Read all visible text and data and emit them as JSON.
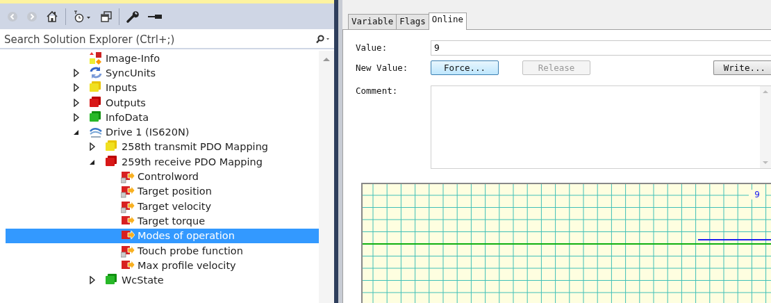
{
  "solution_explorer": {
    "toolbar": [
      {
        "kind": "back",
        "disabled": true
      },
      {
        "kind": "forward",
        "disabled": true
      },
      {
        "kind": "home"
      },
      {
        "kind": "separator"
      },
      {
        "kind": "history"
      },
      {
        "kind": "windows"
      },
      {
        "kind": "separator"
      },
      {
        "kind": "wrench"
      },
      {
        "kind": "pin"
      }
    ],
    "search": {
      "placeholder": "Search Solution Explorer (Ctrl+;)"
    },
    "tree": [
      {
        "label": "Image-Info",
        "kind": "image-info",
        "selected": false
      },
      {
        "label": "SyncUnits",
        "kind": "sync",
        "expanded": false,
        "selected": false
      },
      {
        "label": "Inputs",
        "kind": "inputs",
        "expanded": false,
        "selected": false
      },
      {
        "label": "Outputs",
        "kind": "outputs",
        "expanded": false,
        "selected": false
      },
      {
        "label": "InfoData",
        "kind": "info",
        "expanded": false,
        "selected": false
      },
      {
        "label": "Drive 1 (IS620N)",
        "kind": "drive",
        "expanded": true,
        "selected": false,
        "children": [
          {
            "label": "258th transmit PDO Mapping",
            "kind": "inputs",
            "expanded": false,
            "selected": false
          },
          {
            "label": "259th receive PDO Mapping",
            "kind": "outputs",
            "expanded": true,
            "selected": false,
            "children": [
              {
                "label": "Controlword",
                "kind": "linked-output-var",
                "selected": false
              },
              {
                "label": "Target position",
                "kind": "linked-output-var",
                "selected": false
              },
              {
                "label": "Target velocity",
                "kind": "linked-output-var",
                "selected": false
              },
              {
                "label": "Target torque",
                "kind": "output-var",
                "selected": false
              },
              {
                "label": "Modes of operation",
                "kind": "output-var",
                "selected": true
              },
              {
                "label": "Touch probe function",
                "kind": "linked-output-var",
                "selected": false
              },
              {
                "label": "Max profile velocity",
                "kind": "output-var",
                "selected": false
              }
            ]
          },
          {
            "label": "WcState",
            "kind": "info",
            "expanded": false,
            "selected": false
          }
        ]
      }
    ]
  },
  "properties": {
    "tabs": [
      {
        "label": "Variable",
        "selected": false
      },
      {
        "label": "Flags",
        "selected": false
      },
      {
        "label": "Online",
        "selected": true
      }
    ],
    "value": {
      "label": "Value:",
      "value": "9"
    },
    "new_value": {
      "label": "New Value:",
      "buttons": [
        {
          "label": "Force...",
          "kind": "force",
          "default": true,
          "disabled": false
        },
        {
          "label": "Release",
          "kind": "release",
          "default": false,
          "disabled": true
        },
        {
          "label": "Write...",
          "kind": "write",
          "default": false,
          "disabled": false
        }
      ]
    },
    "comment": {
      "label": "Comment:"
    },
    "graph": {
      "value_label": "9"
    }
  }
}
